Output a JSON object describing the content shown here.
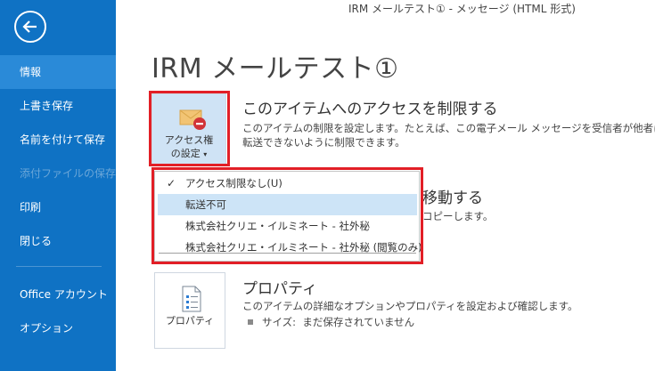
{
  "window": {
    "title": "IRM メールテスト① - メッセージ (HTML 形式)"
  },
  "sidebar": {
    "items": [
      {
        "label": "情報",
        "active": true
      },
      {
        "label": "上書き保存"
      },
      {
        "label": "名前を付けて保存"
      },
      {
        "label": "添付ファイルの保存",
        "disabled": true
      },
      {
        "label": "印刷"
      },
      {
        "label": "閉じる"
      },
      {
        "label": "Office アカウント"
      },
      {
        "label": "オプション"
      }
    ]
  },
  "page": {
    "title": "IRM メールテスト①"
  },
  "rights_section": {
    "button_label_line1": "アクセス権",
    "button_label_line2": "の設定",
    "title": "このアイテムへのアクセスを制限する",
    "desc_line1": "このアイテムの制限を設定します。たとえば、この電子メール メッセージを受信者が他者に",
    "desc_line2": "転送できないように制限できます。"
  },
  "dropdown": {
    "items": [
      {
        "label": "アクセス制限なし(U)",
        "checked": true
      },
      {
        "label": "転送不可",
        "highlighted": true
      },
      {
        "label": "株式会社クリエ・イルミネート - 社外秘"
      },
      {
        "label": "株式会社クリエ・イルミネート - 社外秘 (閲覧のみ)"
      }
    ]
  },
  "move_section": {
    "title_fragment": "移動する",
    "desc_fragment": "コピーします。"
  },
  "properties_section": {
    "button_label": "プロパティ",
    "title": "プロパティ",
    "desc": "このアイテムの詳細なオプションやプロパティを設定および確認します。",
    "size_label": "サイズ:",
    "size_value": "まだ保存されていません"
  },
  "colors": {
    "sidebar_bg": "#0f72c4",
    "sidebar_active": "#2a8ad8",
    "highlight_outline": "#e21f26",
    "dropdown_hover": "#cde4f7"
  },
  "icons": {
    "back": "back-arrow-icon",
    "rights": "envelope-restrict-icon",
    "properties": "document-properties-icon",
    "check": "checkmark-icon"
  }
}
